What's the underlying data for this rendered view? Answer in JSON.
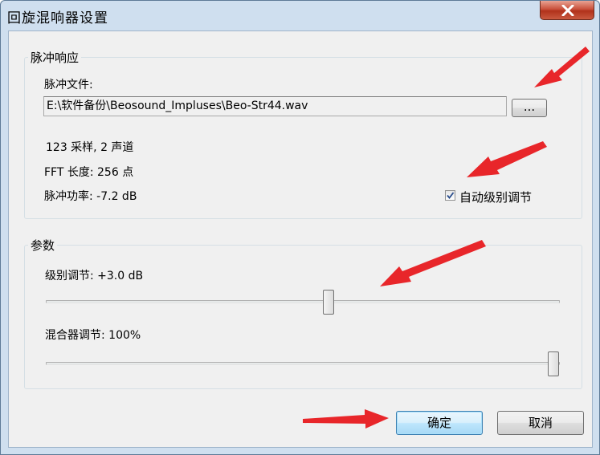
{
  "window": {
    "title": "回旋混响器设置"
  },
  "impulse_group": {
    "title": "脉冲响应",
    "file_label": "脉冲文件:",
    "file_path": "E:\\软件备份\\Beosound_Impluses\\Beo-Str44.wav",
    "browse_label": "...",
    "samples_info": "123 采样, 2 声道",
    "fft_info": "FFT 长度: 256 点",
    "power_info": "脉冲功率: -7.2 dB",
    "auto_level": {
      "label": "自动级别调节",
      "checked": true
    }
  },
  "params_group": {
    "title": "参数",
    "level_label": "级别调节: +3.0 dB",
    "level_slider_position": 0.55,
    "mixer_label": "混合器调节: 100%",
    "mixer_slider_position": 1.0
  },
  "buttons": {
    "ok": "确定",
    "cancel": "取消"
  },
  "colors": {
    "arrow": "#e8262a",
    "title_bar": "#cfdfef",
    "close_button": "#c9513c"
  }
}
